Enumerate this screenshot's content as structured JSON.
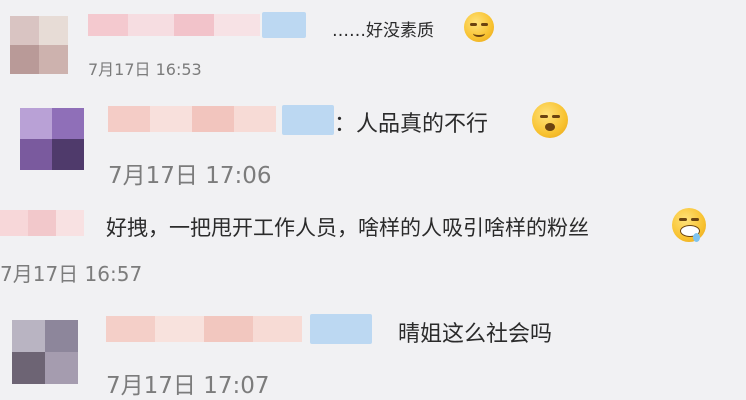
{
  "comments": [
    {
      "text": "……好没素质",
      "time": "7月17日 16:53",
      "emoji": "smirk-emoji"
    },
    {
      "text": "：人品真的不行",
      "time": "7月17日 17:06",
      "emoji": "giggle-emoji"
    },
    {
      "text": "好拽，一把甩开工作人员，啥样的人吸引啥样的粉丝",
      "time": "7月17日 16:57",
      "emoji": "drool-emoji"
    },
    {
      "text": "晴姐这么社会吗",
      "time": "7月17日 17:07",
      "emoji": ""
    }
  ]
}
